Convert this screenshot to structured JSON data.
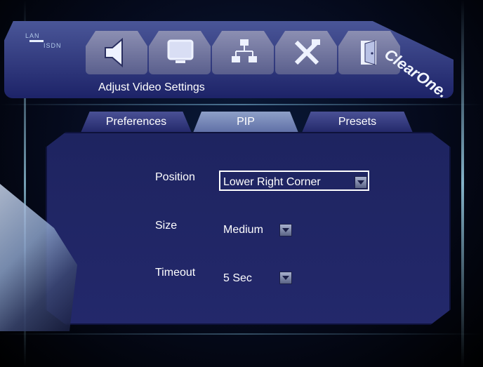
{
  "header": {
    "title": "Adjust Video Settings",
    "lan_label": "LAN",
    "isdn_label": "ISDN",
    "brand": "ClearOne."
  },
  "icons": [
    {
      "name": "speaker-icon"
    },
    {
      "name": "monitor-icon"
    },
    {
      "name": "network-icon"
    },
    {
      "name": "tools-icon"
    },
    {
      "name": "exit-door-icon"
    }
  ],
  "tabs": [
    {
      "label": "Preferences",
      "active": false
    },
    {
      "label": "PIP",
      "active": true
    },
    {
      "label": "Presets",
      "active": false
    }
  ],
  "settings": {
    "position": {
      "label": "Position",
      "value": "Lower Right Corner"
    },
    "size": {
      "label": "Size",
      "value": "Medium"
    },
    "timeout": {
      "label": "Timeout",
      "value": "5 Sec"
    }
  },
  "colors": {
    "panel": "#1e2460",
    "tab_active": "#8ea0c8",
    "tab_inactive": "#3b4287",
    "text": "#ffffff"
  }
}
